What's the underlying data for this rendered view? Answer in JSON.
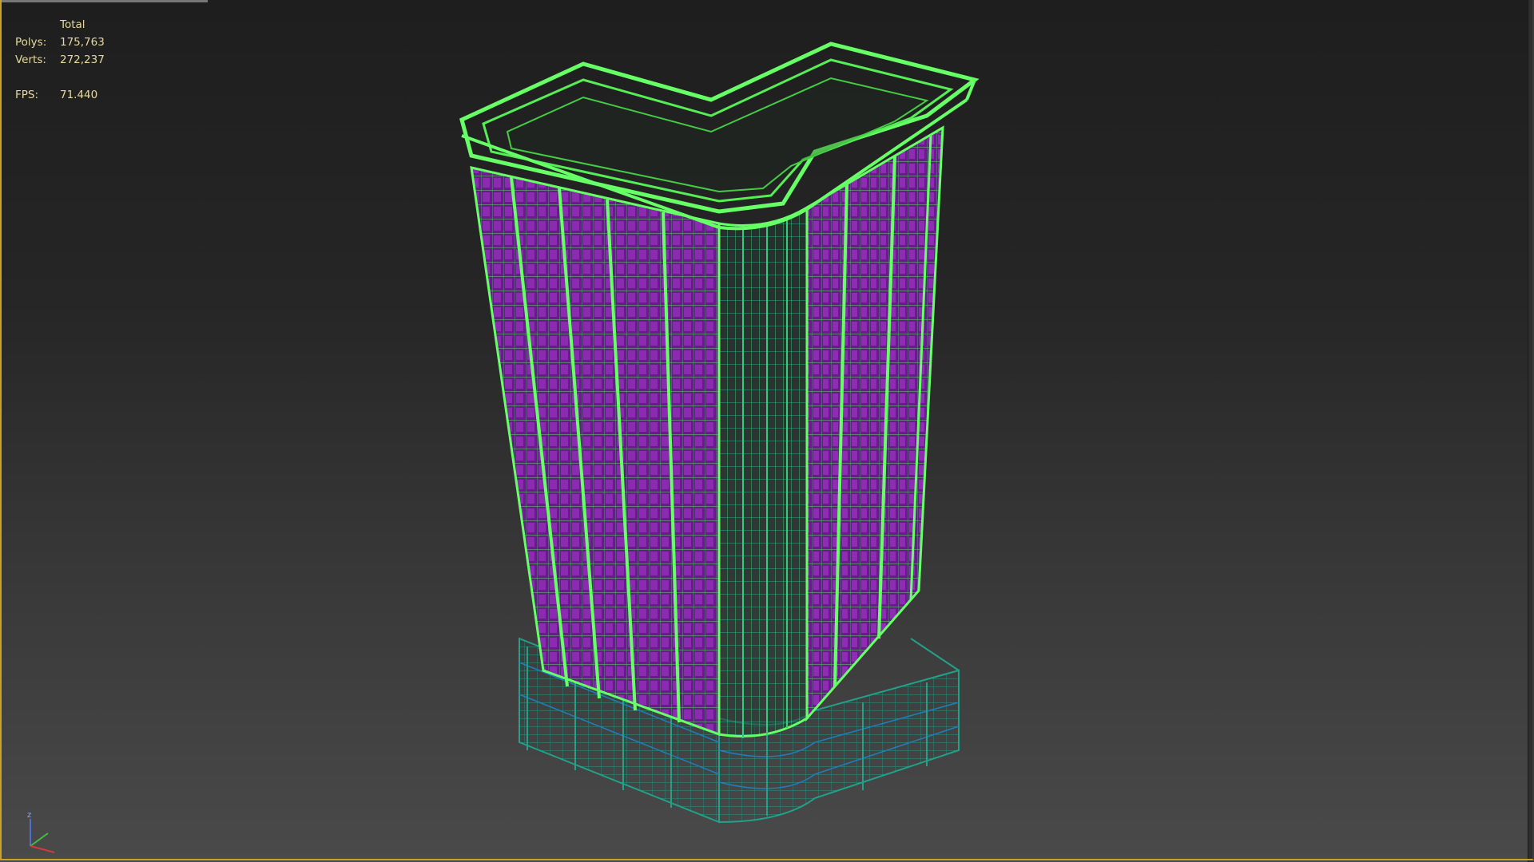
{
  "viewport": {
    "stats": {
      "header": "Total",
      "polys_label": "Polys:",
      "polys_value": "175,763",
      "verts_label": "Verts:",
      "verts_value": "272,237",
      "fps_label": "FPS:",
      "fps_value": "71.440"
    },
    "axis": {
      "z_label": "z"
    }
  },
  "colors": {
    "wire_bright": "#66ff66",
    "wire_teal": "#22a088",
    "glass": "#7a1fa0",
    "stats_text": "#e6d9a0",
    "viewport_border": "#c9a227"
  }
}
